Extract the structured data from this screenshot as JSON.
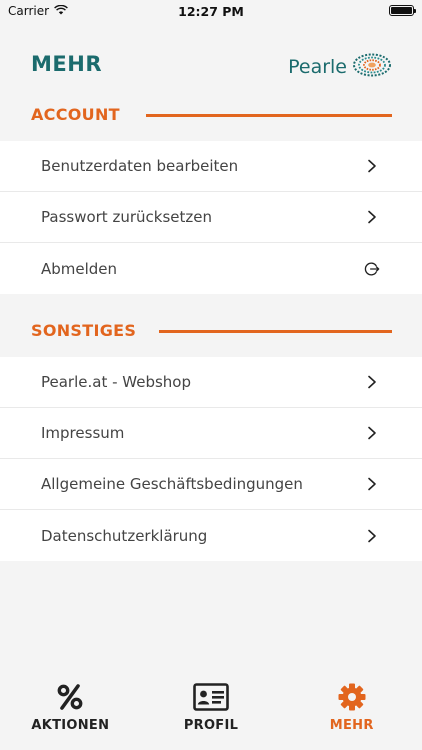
{
  "status_bar": {
    "carrier": "Carrier",
    "time": "12:27 PM",
    "battery_level": 1.0
  },
  "header": {
    "title": "MEHR",
    "brand": "Pearle",
    "brand_icon": "pearle-logo-icon"
  },
  "account": {
    "title": "ACCOUNT",
    "items": [
      {
        "label": "Benutzerdaten bearbeiten",
        "icon": "chevron-right-icon"
      },
      {
        "label": "Passwort zurücksetzen",
        "icon": "chevron-right-icon"
      },
      {
        "label": "Abmelden",
        "icon": "logout-icon"
      }
    ]
  },
  "sonstiges": {
    "title": "SONSTIGES",
    "items": [
      {
        "label": "Pearle.at - Webshop",
        "icon": "chevron-right-icon"
      },
      {
        "label": "Impressum",
        "icon": "chevron-right-icon"
      },
      {
        "label": "Allgemeine Geschäftsbedingungen",
        "icon": "chevron-right-icon"
      },
      {
        "label": "Datenschutzerklärung",
        "icon": "chevron-right-icon"
      }
    ]
  },
  "tabbar": {
    "tabs": [
      {
        "label": "AKTIONEN",
        "icon": "percent-icon",
        "active": false
      },
      {
        "label": "PROFIL",
        "icon": "id-card-icon",
        "active": false
      },
      {
        "label": "MEHR",
        "icon": "gear-icon",
        "active": true
      }
    ]
  },
  "colors": {
    "accent": "#e2651e",
    "brand": "#1b6b6d",
    "background": "#f4f4f4"
  }
}
